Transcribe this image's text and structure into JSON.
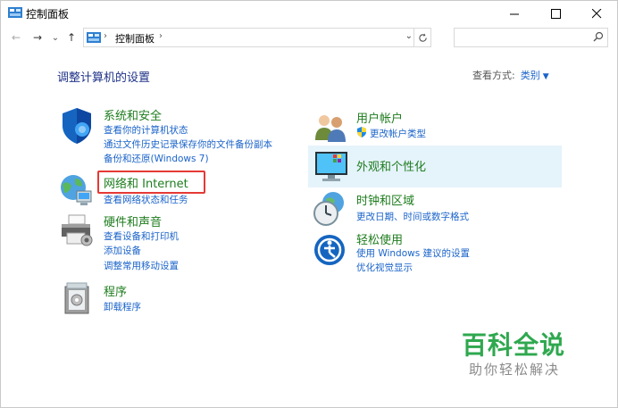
{
  "window": {
    "title": "控制面板",
    "minimize_glyph": "—",
    "maximize_glyph": "☐",
    "close_glyph": "✕"
  },
  "nav": {
    "back": "←",
    "forward": "→",
    "recent": "⌄",
    "up": "↑",
    "breadcrumb": [
      "控制面板"
    ],
    "search_placeholder": ""
  },
  "heading": "调整计算机的设置",
  "view_by": {
    "label": "查看方式:",
    "value": "类别"
  },
  "categories_left": [
    {
      "title": "系统和安全",
      "icon": "shield-icon",
      "links": [
        "查看你的计算机状态",
        "通过文件历史记录保存你的文件备份副本",
        "备份和还原(Windows 7)"
      ]
    },
    {
      "title": "网络和 Internet",
      "icon": "globe-network-icon",
      "links": [
        "查看网络状态和任务"
      ]
    },
    {
      "title": "硬件和声音",
      "icon": "printer-icon",
      "links": [
        "查看设备和打印机",
        "添加设备",
        "调整常用移动设置"
      ]
    },
    {
      "title": "程序",
      "icon": "programs-icon",
      "links": [
        "卸载程序"
      ]
    }
  ],
  "categories_right": [
    {
      "title": "用户帐户",
      "icon": "users-icon",
      "links": [
        "更改帐户类型"
      ]
    },
    {
      "title": "外观和个性化",
      "icon": "display-icon",
      "links": []
    },
    {
      "title": "时钟和区域",
      "icon": "clock-globe-icon",
      "links": [
        "更改日期、时间或数字格式"
      ]
    },
    {
      "title": "轻松使用",
      "icon": "ease-of-access-icon",
      "links": [
        "使用 Windows 建议的设置",
        "优化视觉显示"
      ]
    }
  ],
  "watermark": {
    "main": "百科全说",
    "sub": "助你轻松解决"
  },
  "colors": {
    "link": "#1a63c9",
    "category_title": "#1e7c1e",
    "heading": "#1e3287",
    "highlight": "#e53935",
    "hover": "#e5f3fb",
    "watermark": "#2fa84f"
  }
}
